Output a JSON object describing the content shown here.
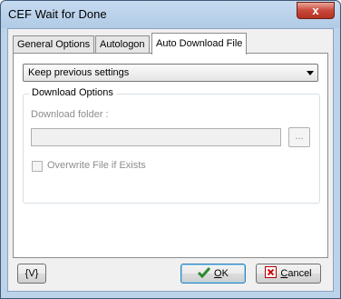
{
  "window": {
    "title": "CEF Wait for Done",
    "close_label": "x"
  },
  "tabs": [
    {
      "label": "General Options"
    },
    {
      "label": "Autologon"
    },
    {
      "label": "Auto Download File"
    }
  ],
  "panel": {
    "mode_select": {
      "value": "Keep previous settings"
    },
    "group_title": "Download Options",
    "download_folder_label": "Download folder :",
    "download_folder_value": "",
    "browse_label": "...",
    "overwrite_label": "Overwrite File if Exists",
    "overwrite_checked": false
  },
  "footer": {
    "variables_label": "{V}",
    "ok_label_prefix": "",
    "ok_label_ul": "O",
    "ok_label_rest": "K",
    "cancel_label_ul": "C",
    "cancel_label_rest": "ancel"
  },
  "colors": {
    "ok_icon": "#2d8a2d",
    "cancel_icon": "#cc0000",
    "close_button": "#c9483a"
  }
}
